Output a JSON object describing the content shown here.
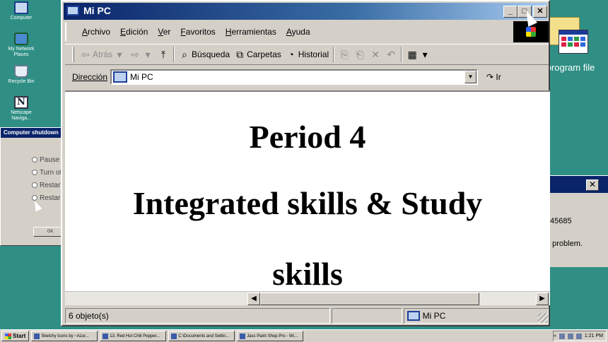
{
  "desktop": {
    "icons": [
      {
        "label": "Computer",
        "icon": "my-computer-icon"
      },
      {
        "label": "My Network Places",
        "icon": "network-places-icon"
      },
      {
        "label": "Recycle Bin",
        "icon": "recycle-bin-icon"
      },
      {
        "label": "Netscape Naviga...",
        "icon": "netscape-icon"
      }
    ],
    "program_label": "program file"
  },
  "shutdown_dialog": {
    "title": "Computer shutdown",
    "options": [
      "Pause",
      "Turn of",
      "Restar",
      "Restar"
    ],
    "ok_label": "OK"
  },
  "error_dialog": {
    "close_glyph": "✕",
    "line1": ":45685",
    "line2": ": problem."
  },
  "window": {
    "title": "Mi PC",
    "buttons": {
      "minimize": "_",
      "maximize": "□",
      "close": "✕"
    },
    "menu": [
      "Archivo",
      "Edición",
      "Ver",
      "Favoritos",
      "Herramientas",
      "Ayuda"
    ],
    "toolbar": {
      "back": "Atrás",
      "search": "Búsqueda",
      "folders": "Carpetas",
      "history": "Historial"
    },
    "address": {
      "label": "Dirección",
      "value": "Mi PC",
      "go": "Ir"
    },
    "content": {
      "line1": "Period 4",
      "line2": "Integrated skills & Study",
      "line3": "skills"
    },
    "status": {
      "objects": "6 objeto(s)",
      "location": "Mi PC"
    }
  },
  "taskbar": {
    "start": "Start",
    "tasks": [
      "Sketchy Icons by ~Azur...",
      "13. Red Hot Chili Pepper...",
      "C:\\Documents and Settin...",
      "Jasc Paint Shop Pro - Wi..."
    ],
    "clock": "1:21 PM",
    "tray_chevron": "«"
  }
}
